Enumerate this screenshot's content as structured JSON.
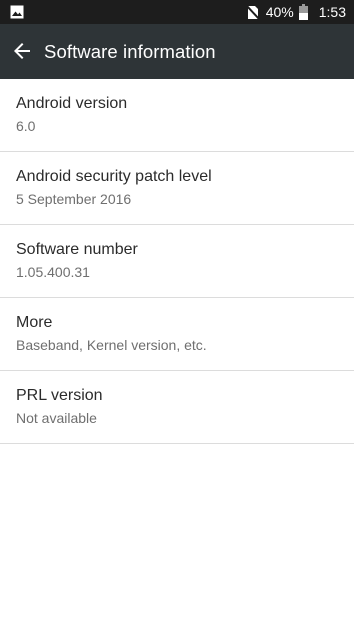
{
  "status_bar": {
    "left_icon": "image-icon",
    "battery_percent": "40%",
    "time": "1:53",
    "icons": [
      "no-sim-icon",
      "battery-icon"
    ]
  },
  "app_bar": {
    "back_icon": "back-arrow-icon",
    "title": "Software information"
  },
  "items": [
    {
      "title": "Android version",
      "summary": "6.0"
    },
    {
      "title": "Android security patch level",
      "summary": "5 September 2016"
    },
    {
      "title": "Software number",
      "summary": "1.05.400.31"
    },
    {
      "title": "More",
      "summary": "Baseband, Kernel version, etc."
    },
    {
      "title": "PRL version",
      "summary": "Not available"
    }
  ]
}
